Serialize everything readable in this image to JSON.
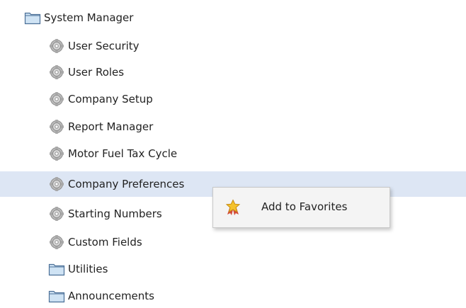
{
  "tree": {
    "items": [
      {
        "label": "System Manager",
        "icon": "folder-icon",
        "level": 0
      },
      {
        "label": "User Security",
        "icon": "gear-icon",
        "level": 1
      },
      {
        "label": "User Roles",
        "icon": "gear-icon",
        "level": 1
      },
      {
        "label": "Company Setup",
        "icon": "gear-icon",
        "level": 1
      },
      {
        "label": "Report Manager",
        "icon": "gear-icon",
        "level": 1
      },
      {
        "label": "Motor Fuel Tax Cycle",
        "icon": "gear-icon",
        "level": 1
      },
      {
        "label": "Company Preferences",
        "icon": "gear-icon",
        "level": 1,
        "selected": true
      },
      {
        "label": "Starting Numbers",
        "icon": "gear-icon",
        "level": 1
      },
      {
        "label": "Custom Fields",
        "icon": "gear-icon",
        "level": 1
      },
      {
        "label": "Utilities",
        "icon": "folder-icon",
        "level": 1
      },
      {
        "label": "Announcements",
        "icon": "folder-icon",
        "level": 1
      }
    ]
  },
  "context_menu": {
    "items": [
      {
        "label": "Add to Favorites",
        "icon": "favorite-star-icon"
      }
    ]
  },
  "colors": {
    "selected_row": "#dde6f4",
    "menu_background": "#f4f4f4",
    "text": "#222222",
    "folder_fill": "#cfe3f4",
    "folder_stroke": "#4a6f97",
    "gear_fill": "#bdbdbd",
    "star_fill": "#f5c22b",
    "ribbon_fill": "#d44b3a"
  }
}
